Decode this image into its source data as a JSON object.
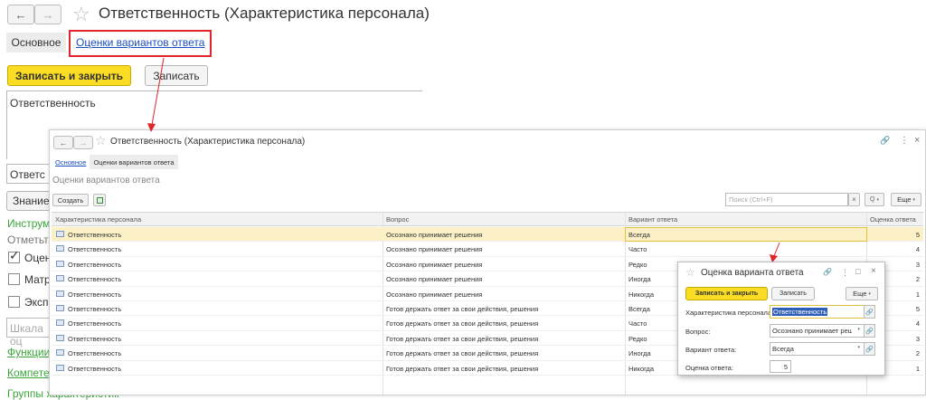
{
  "outer": {
    "nav_back": "←",
    "nav_forward": "→",
    "title": "Ответственность (Характеристика персонала)",
    "tab_main": "Основное",
    "tab_ratings": "Оценки вариантов ответа",
    "btn_save_close": "Записать и закрыть",
    "btn_save": "Записать",
    "description_text": "Ответственность",
    "field_partial": "Ответс",
    "button_partial": "Знание",
    "tools_partial": "Инструм",
    "mark_partial": "Отметьте",
    "check1_partial": "Оцен",
    "check2_partial": "Матр",
    "check3_partial": "Экспе",
    "scale_partial": "Шкала оц",
    "link_functions_partial": "Функции",
    "link_competences_partial": "Компетен",
    "bottom_partial": "Группы характеристик"
  },
  "inner": {
    "nav_back": "←",
    "nav_forward": "→",
    "title": "Ответственность (Характеристика персонала)",
    "tab_main": "Основное",
    "tab_ratings": "Оценки вариантов ответа",
    "section_title": "Оценки вариантов ответа",
    "btn_create": "Создать",
    "search_placeholder": "Поиск (Ctrl+F)",
    "search_clear": "×",
    "search_btn": "Q",
    "more_btn": "Еще",
    "win_link": "🔗",
    "win_more": "⋮",
    "win_close": "×",
    "columns": {
      "characteristic": "Характеристика персонала",
      "question": "Вопрос",
      "answer": "Вариант ответа",
      "score": "Оценка ответа"
    },
    "rows": [
      {
        "characteristic": "Ответственность",
        "question": "Осознано принимает решения",
        "answer": "Всегда",
        "score": "5"
      },
      {
        "characteristic": "Ответственность",
        "question": "Осознано принимает решения",
        "answer": "Часто",
        "score": "4"
      },
      {
        "characteristic": "Ответственность",
        "question": "Осознано принимает решения",
        "answer": "Редко",
        "score": "3"
      },
      {
        "characteristic": "Ответственность",
        "question": "Осознано принимает решения",
        "answer": "Иногда",
        "score": "2"
      },
      {
        "characteristic": "Ответственность",
        "question": "Осознано принимает решения",
        "answer": "Никогда",
        "score": "1"
      },
      {
        "characteristic": "Ответственность",
        "question": "Готов держать ответ за свои действия, решения",
        "answer": "Всегда",
        "score": "5"
      },
      {
        "characteristic": "Ответственность",
        "question": "Готов держать ответ за свои действия, решения",
        "answer": "Часто",
        "score": "4"
      },
      {
        "characteristic": "Ответственность",
        "question": "Готов держать ответ за свои действия, решения",
        "answer": "Редко",
        "score": "3"
      },
      {
        "characteristic": "Ответственность",
        "question": "Готов держать ответ за свои действия, решения",
        "answer": "Иногда",
        "score": "2"
      },
      {
        "characteristic": "Ответственность",
        "question": "Готов держать ответ за свои действия, решения",
        "answer": "Никогда",
        "score": "1"
      }
    ]
  },
  "dialog": {
    "title": "Оценка варианта ответа",
    "link_icon": "🔗",
    "more_icon": "⋮",
    "maximize_icon": "□",
    "close_icon": "×",
    "btn_save_close": "Записать и закрыть",
    "btn_save": "Записать",
    "btn_more": "Еще",
    "label_characteristic": "Характеристика персонала:",
    "value_characteristic": "Ответственность",
    "label_question": "Вопрос:",
    "value_question": "Осознано принимает реш",
    "label_answer": "Вариант ответа:",
    "value_answer": "Всегда",
    "label_score": "Оценка ответа:",
    "value_score": "5"
  },
  "colors": {
    "accent_yellow": "#f9dc23",
    "highlight_red": "#e0262b",
    "link_blue": "#1c4fbf",
    "green_link": "#3aa63a",
    "selected_row": "#fbf0c6"
  }
}
